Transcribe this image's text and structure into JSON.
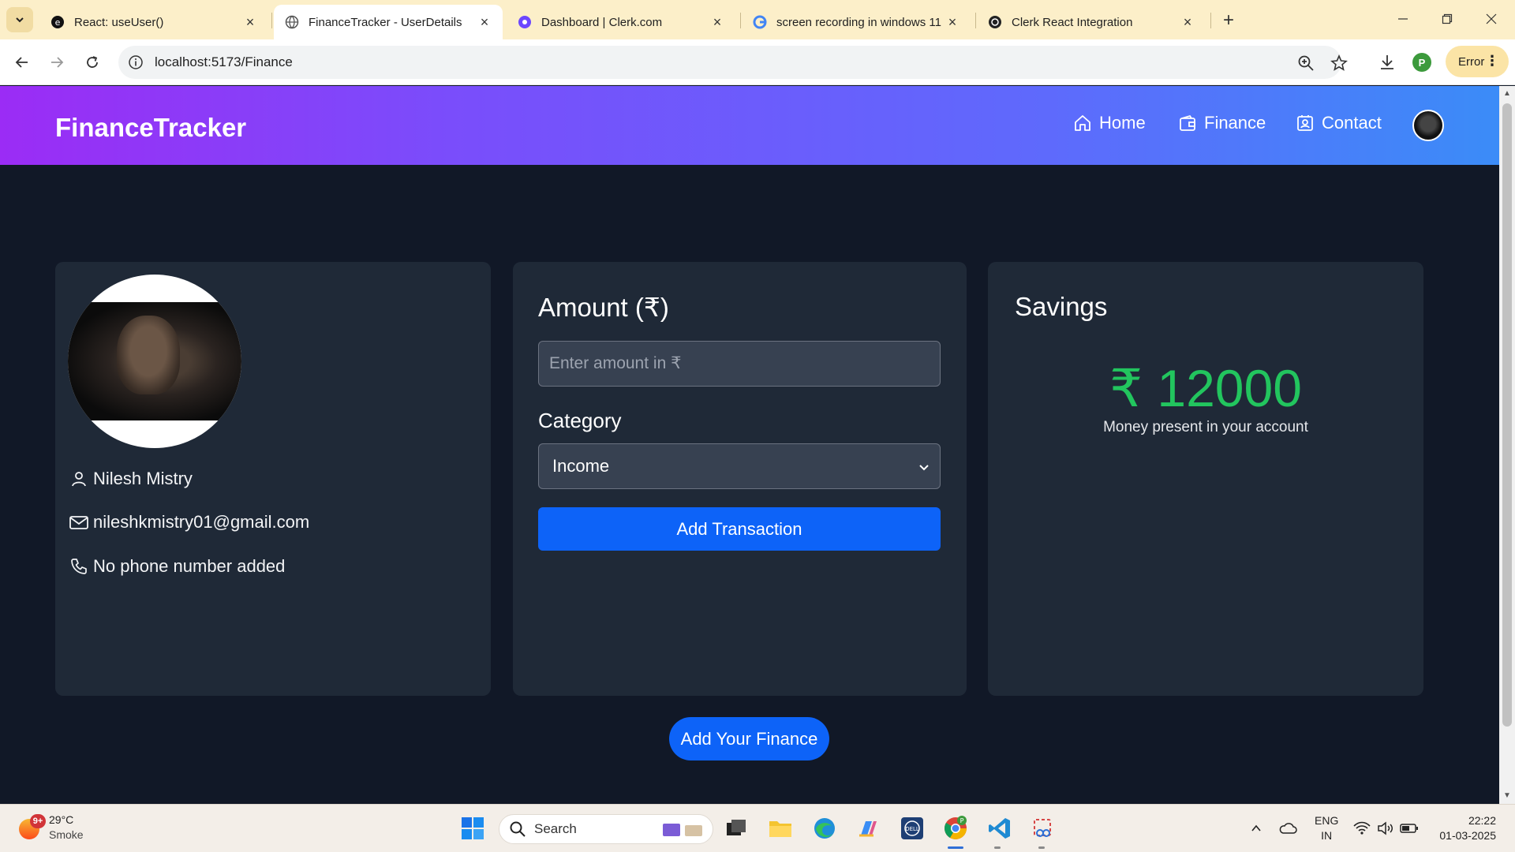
{
  "browser": {
    "tabs": [
      {
        "title": "React: useUser()",
        "active": false
      },
      {
        "title": "FinanceTracker - UserDetails",
        "active": true
      },
      {
        "title": "Dashboard | Clerk.com",
        "active": false
      },
      {
        "title": "screen recording in windows 11",
        "active": false
      },
      {
        "title": "Clerk React Integration",
        "active": false
      }
    ],
    "url": "localhost:5173/Finance",
    "profile_initial": "P",
    "error_label": "Error"
  },
  "app": {
    "brand": "FinanceTracker",
    "nav": {
      "home": "Home",
      "finance": "Finance",
      "contact": "Contact"
    },
    "profile": {
      "name": "Nilesh Mistry",
      "email": "nileshkmistry01@gmail.com",
      "phone": "No phone number added"
    },
    "transaction_form": {
      "heading": "Amount (₹)",
      "amount_placeholder": "Enter amount in ₹",
      "category_label": "Category",
      "category_selected": "Income",
      "submit_label": "Add Transaction"
    },
    "savings": {
      "heading": "Savings",
      "amount": "₹ 12000",
      "caption": "Money present in your account"
    },
    "add_finance_label": "Add Your Finance",
    "colors": {
      "accent": "#0d63f8",
      "savings": "#22c55e",
      "card": "#1f2937",
      "background": "#111827"
    }
  },
  "taskbar": {
    "weather": {
      "badge": "9+",
      "temp": "29°C",
      "condition": "Smoke"
    },
    "search_label": "Search",
    "language": {
      "lang": "ENG",
      "region": "IN"
    },
    "clock": {
      "time": "22:22",
      "date": "01-03-2025"
    }
  }
}
